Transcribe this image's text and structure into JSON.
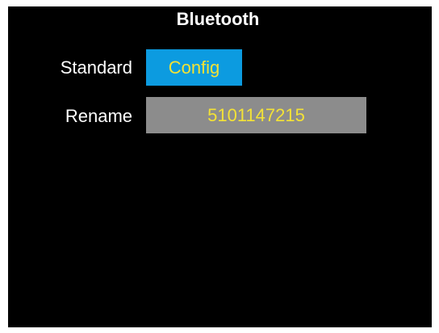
{
  "header": {
    "title": "Bluetooth"
  },
  "settings": {
    "standard_label": "Standard",
    "standard_button": "Config",
    "rename_label": "Rename",
    "rename_value": "5101147215"
  },
  "colors": {
    "background": "#000000",
    "button_bg": "#0c9be0",
    "field_bg": "#8c8c8c",
    "value_text": "#f3e236",
    "label_text": "#ffffff"
  }
}
